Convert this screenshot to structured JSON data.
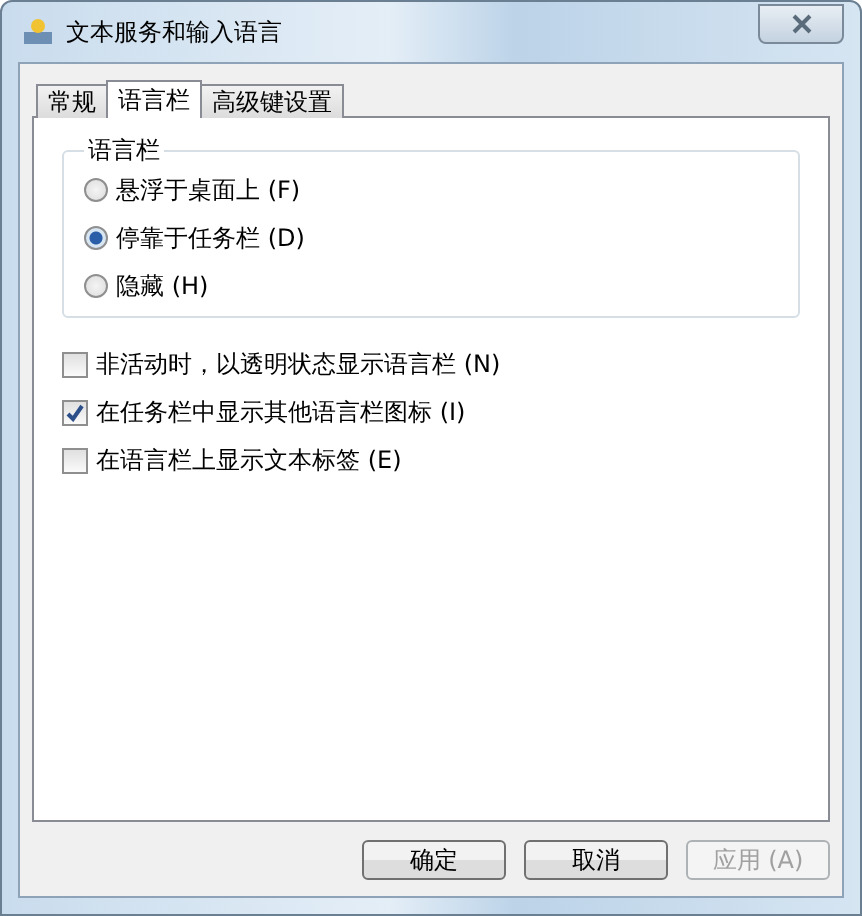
{
  "window": {
    "title": "文本服务和输入语言"
  },
  "tabs": [
    {
      "label": "常规",
      "selected": false
    },
    {
      "label": "语言栏",
      "selected": true
    },
    {
      "label": "高级键设置",
      "selected": false
    }
  ],
  "group": {
    "title": "语言栏",
    "options": [
      {
        "label": "悬浮于桌面上 (F)",
        "selected": false
      },
      {
        "label": "停靠于任务栏 (D)",
        "selected": true
      },
      {
        "label": "隐藏 (H)",
        "selected": false
      }
    ]
  },
  "checkboxes": [
    {
      "label": "非活动时，以透明状态显示语言栏 (N)",
      "checked": false
    },
    {
      "label": "在任务栏中显示其他语言栏图标 (I)",
      "checked": true
    },
    {
      "label": "在语言栏上显示文本标签 (E)",
      "checked": false
    }
  ],
  "buttons": [
    {
      "label": "确定",
      "disabled": false
    },
    {
      "label": "取消",
      "disabled": false
    },
    {
      "label": "应用 (A)",
      "disabled": true
    }
  ]
}
